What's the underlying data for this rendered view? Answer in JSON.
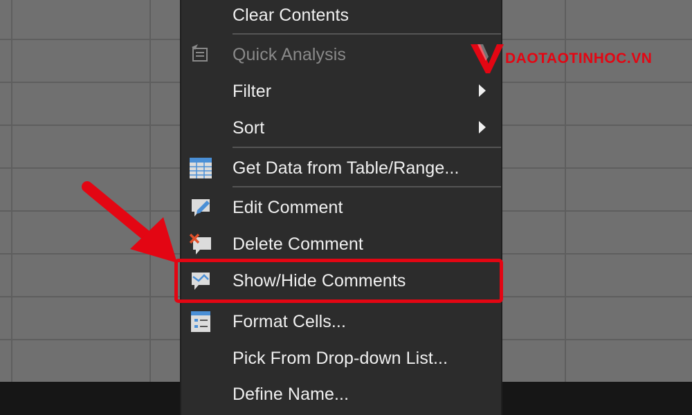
{
  "menu": {
    "items": [
      {
        "label": "Clear Contents",
        "disabled": false,
        "icon": "",
        "submenu": false
      },
      {
        "label": "Quick Analysis",
        "disabled": true,
        "icon": "quick-analysis-icon",
        "submenu": false
      },
      {
        "label": "Filter",
        "disabled": false,
        "icon": "",
        "submenu": true
      },
      {
        "label": "Sort",
        "disabled": false,
        "icon": "",
        "submenu": true
      },
      {
        "label": "Get Data from Table/Range...",
        "disabled": false,
        "icon": "table-icon",
        "submenu": false
      },
      {
        "label": "Edit Comment",
        "disabled": false,
        "icon": "edit-comment-icon",
        "submenu": false
      },
      {
        "label": "Delete Comment",
        "disabled": false,
        "icon": "delete-comment-icon",
        "submenu": false
      },
      {
        "label": "Show/Hide Comments",
        "disabled": false,
        "icon": "show-hide-comments-icon",
        "submenu": false,
        "highlighted": true
      },
      {
        "label": "Format Cells...",
        "disabled": false,
        "icon": "format-cells-icon",
        "submenu": false
      },
      {
        "label": "Pick From Drop-down List...",
        "disabled": false,
        "icon": "",
        "submenu": false
      },
      {
        "label": "Define Name...",
        "disabled": false,
        "icon": "",
        "submenu": false
      }
    ]
  },
  "watermark": {
    "text": "DAOTAOTINHOC.VN"
  },
  "colors": {
    "accent": "#e30613",
    "menu_bg": "#2c2c2c",
    "text": "#f0f0f0"
  }
}
